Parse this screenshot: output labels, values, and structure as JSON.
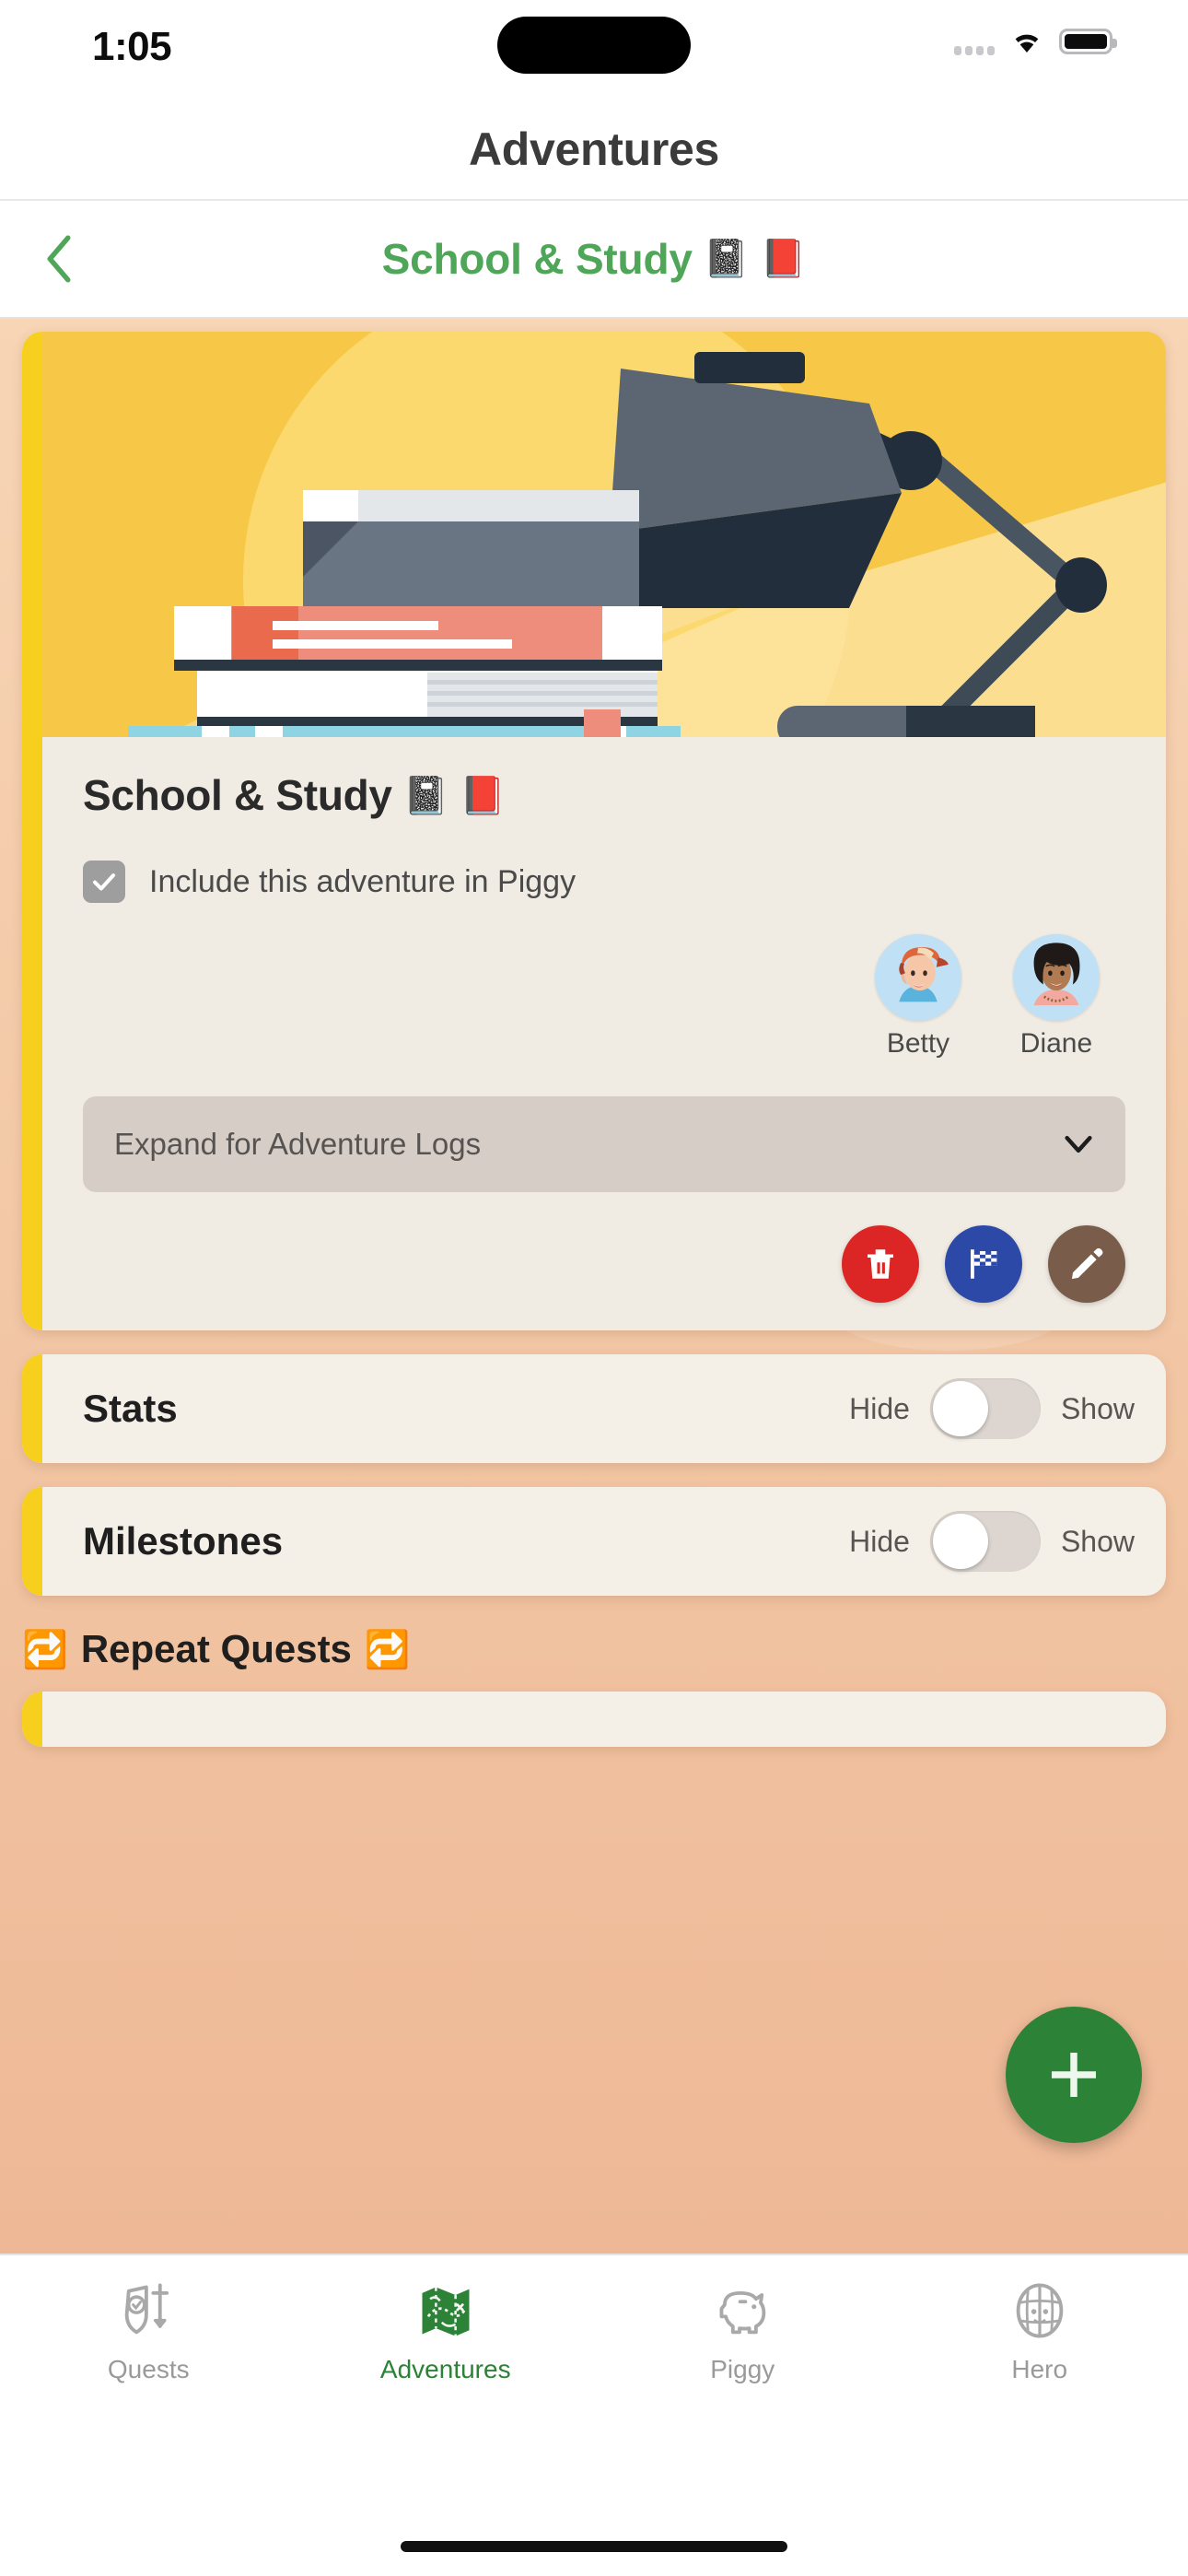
{
  "status_bar": {
    "time": "1:05",
    "signal_icon": "cellular-signal-icon",
    "wifi_icon": "wifi-icon",
    "battery_icon": "battery-icon"
  },
  "header": {
    "app_title": "Adventures"
  },
  "sub_header": {
    "back_icon": "chevron-left-icon",
    "title": "School & Study",
    "emoji_notebook": "📓",
    "emoji_book": "📕",
    "accent_color": "#4fa659"
  },
  "adventure_card": {
    "illustration_name": "desk-lamp-books-illustration",
    "title": "School & Study",
    "emoji_notebook": "📓",
    "emoji_book": "📕",
    "checkbox": {
      "label": "Include this adventure in Piggy",
      "checked": true
    },
    "members": [
      {
        "name": "Betty",
        "avatar": "avatar-betty"
      },
      {
        "name": "Diane",
        "avatar": "avatar-diane"
      }
    ],
    "expand": {
      "label": "Expand for Adventure Logs",
      "chevron": "chevron-down-icon"
    },
    "actions": [
      {
        "name": "delete-button",
        "icon": "trash-icon",
        "color": "#dc2626"
      },
      {
        "name": "finish-button",
        "icon": "checkered-flag-icon",
        "color": "#2c49a8"
      },
      {
        "name": "edit-button",
        "icon": "pencil-icon",
        "color": "#7a5c4b"
      }
    ],
    "accent_color": "#f7cf1e"
  },
  "sections": [
    {
      "title": "Stats",
      "hide_label": "Hide",
      "show_label": "Show",
      "toggle_state": "hide"
    },
    {
      "title": "Milestones",
      "hide_label": "Hide",
      "show_label": "Show",
      "toggle_state": "hide"
    }
  ],
  "repeat_quests": {
    "emoji_left": "🔁",
    "title": "Repeat Quests",
    "emoji_right": "🔁"
  },
  "fab": {
    "icon": "plus-icon",
    "color": "#2c8236"
  },
  "tab_bar": {
    "tabs": [
      {
        "label": "Quests",
        "icon": "shield-sword-icon",
        "active": false
      },
      {
        "label": "Adventures",
        "icon": "map-icon",
        "active": true
      },
      {
        "label": "Piggy",
        "icon": "piggy-bank-icon",
        "active": false
      },
      {
        "label": "Hero",
        "icon": "helmet-icon",
        "active": false
      }
    ],
    "active_color": "#2c8236",
    "inactive_color": "#9a9a9a"
  }
}
